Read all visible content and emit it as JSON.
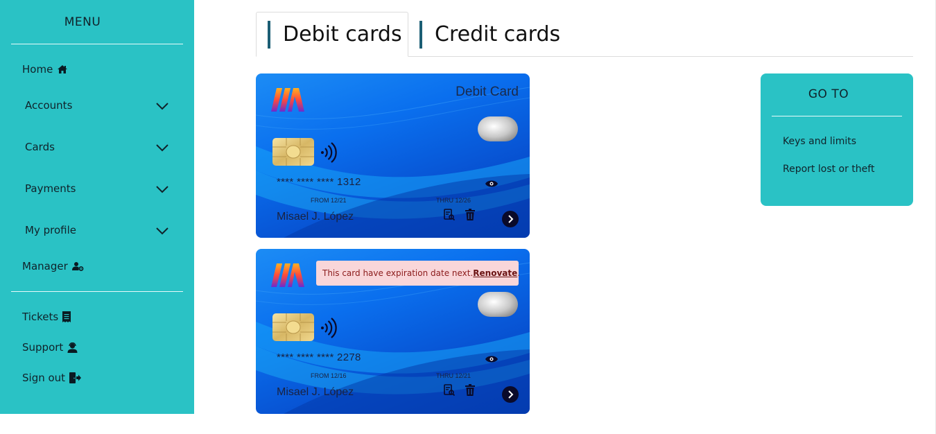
{
  "sidebar": {
    "title": "MENU",
    "items": [
      {
        "label": "Home",
        "icon": "home-icon"
      },
      {
        "label": "Accounts",
        "icon": "chevron-down-icon"
      },
      {
        "label": "Cards",
        "icon": "chevron-down-icon"
      },
      {
        "label": "Payments",
        "icon": "chevron-down-icon"
      },
      {
        "label": "My profile",
        "icon": "chevron-down-icon"
      },
      {
        "label": "Manager",
        "icon": "user-gear-icon"
      },
      {
        "label": "Tickets",
        "icon": "receipt-icon"
      },
      {
        "label": "Support",
        "icon": "headset-user-icon"
      },
      {
        "label": "Sign out",
        "icon": "sign-out-icon"
      }
    ]
  },
  "tabs": [
    {
      "label": "Debit cards",
      "active": true
    },
    {
      "label": "Credit cards",
      "active": false
    }
  ],
  "cards": [
    {
      "type_label": "Debit Card",
      "number": "**** **** **** 1312",
      "from": "FROM 12/21",
      "thru": "THRU 12/26",
      "holder": "Misael J. López"
    },
    {
      "number": "**** **** **** 2278",
      "from": "FROM 12/16",
      "thru": "THRU 12/21",
      "holder": "Misael J. López",
      "alert_text": "This card have expiration date next. ",
      "alert_link": "Renovate",
      "alert_end": "."
    }
  ],
  "goto": {
    "title": "GO TO",
    "links": [
      "Keys and limits",
      "Report lost or theft"
    ]
  },
  "colors": {
    "sidebar_bg": "#2ac2c5",
    "tab_accent": "#1b5e74",
    "card_blue": "#0a6fee",
    "alert_bg": "#f9d6d9",
    "alert_text": "#8b1a1a"
  }
}
